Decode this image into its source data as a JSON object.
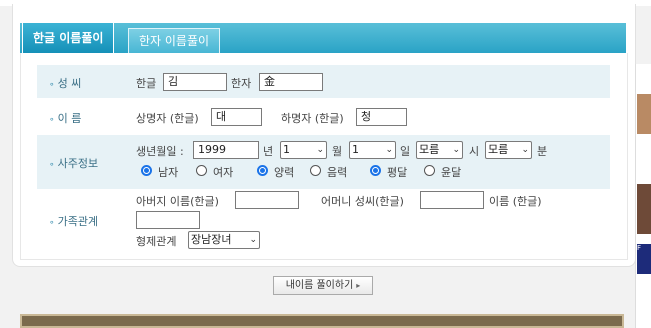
{
  "tabs": [
    {
      "label": "한글 이름풀이",
      "active": true
    },
    {
      "label": "한자 이름풀이",
      "active": false
    }
  ],
  "rows": {
    "surname": {
      "label": "성 씨",
      "hangul_label": "한글",
      "hangul_value": "김",
      "hanja_label": "한자",
      "hanja_value": "金"
    },
    "name": {
      "label": "이 름",
      "upper_label": "상명자 (한글)",
      "upper_value": "대",
      "lower_label": "하명자 (한글)",
      "lower_value": "청"
    },
    "birth": {
      "label": "사주정보",
      "date_label": "생년월일 :",
      "year_value": "1999",
      "year_unit": "년",
      "month_value": "1",
      "month_unit": "월",
      "day_value": "1",
      "day_unit": "일",
      "hour_value": "모름",
      "hour_unit": "시",
      "minute_value": "모름",
      "minute_unit": "분",
      "gender_male": "남자",
      "gender_female": "여자",
      "cal_solar": "양력",
      "cal_lunar": "음력",
      "month_normal": "평달",
      "month_leap": "윤달"
    },
    "family": {
      "label": "가족관계",
      "father_label": "아버지 이름(한글)",
      "father_value": "",
      "mother_surname_label": "어머니 성씨(한글)",
      "mother_surname_value": "",
      "mother_name_label": "이름 (한글)",
      "mother_name_value": "",
      "sibling_label": "형제관계",
      "sibling_value": "장남장녀"
    }
  },
  "submit_label": "내이름 풀이하기",
  "side": {
    "banner_text": "F"
  },
  "colors": {
    "tab_bar": "#2aa3c6",
    "row_shade": "#e7f2f6",
    "label_text": "#3a6f86",
    "radio_on": "#1a73e8"
  }
}
